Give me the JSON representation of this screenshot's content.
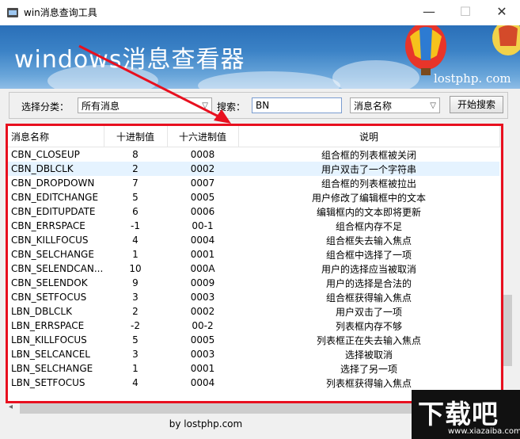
{
  "window": {
    "title": "win消息查询工具",
    "minimize_glyph": "—",
    "maximize_glyph": "☐",
    "close_glyph": "✕"
  },
  "banner": {
    "title": "windows消息查看器",
    "url": "lostphp. com"
  },
  "filter": {
    "category_label": "选择分类：",
    "category_value": "所有消息",
    "search_label": "搜索：",
    "search_value": "BN",
    "field_value": "消息名称",
    "search_button": "开始搜索"
  },
  "table": {
    "columns": [
      "消息名称",
      "十进制值",
      "十六进制值",
      "说明"
    ],
    "rows": [
      [
        "CBN_CLOSEUP",
        "8",
        "0008",
        "组合框的列表框被关闭"
      ],
      [
        "CBN_DBLCLK",
        "2",
        "0002",
        "用户双击了一个字符串"
      ],
      [
        "CBN_DROPDOWN",
        "7",
        "0007",
        "组合框的列表框被拉出"
      ],
      [
        "CBN_EDITCHANGE",
        "5",
        "0005",
        "用户修改了编辑框中的文本"
      ],
      [
        "CBN_EDITUPDATE",
        "6",
        "0006",
        "编辑框内的文本即将更新"
      ],
      [
        "CBN_ERRSPACE",
        "-1",
        "00-1",
        "组合框内存不足"
      ],
      [
        "CBN_KILLFOCUS",
        "4",
        "0004",
        "组合框失去输入焦点"
      ],
      [
        "CBN_SELCHANGE",
        "1",
        "0001",
        "组合框中选择了一项"
      ],
      [
        "CBN_SELENDCAN...",
        "10",
        "000A",
        "用户的选择应当被取消"
      ],
      [
        "CBN_SELENDOK",
        "9",
        "0009",
        "用户的选择是合法的"
      ],
      [
        "CBN_SETFOCUS",
        "3",
        "0003",
        "组合框获得输入焦点"
      ],
      [
        "LBN_DBLCLK",
        "2",
        "0002",
        "用户双击了一项"
      ],
      [
        "LBN_ERRSPACE",
        "-2",
        "00-2",
        "列表框内存不够"
      ],
      [
        "LBN_KILLFOCUS",
        "5",
        "0005",
        "列表框正在失去输入焦点"
      ],
      [
        "LBN_SELCANCEL",
        "3",
        "0003",
        "选择被取消"
      ],
      [
        "LBN_SELCHANGE",
        "1",
        "0001",
        "选择了另一项"
      ],
      [
        "LBN_SETFOCUS",
        "4",
        "0004",
        "列表框获得输入焦点"
      ]
    ],
    "selected_row": 1
  },
  "footer": {
    "text": "by lostphp.com"
  },
  "watermark": {
    "text": "下载吧",
    "sub": "www.xiazaiba.com"
  },
  "colors": {
    "highlight_frame": "#e8101f",
    "arrow": "#e8101f",
    "banner_blue": "#3b82c6"
  }
}
